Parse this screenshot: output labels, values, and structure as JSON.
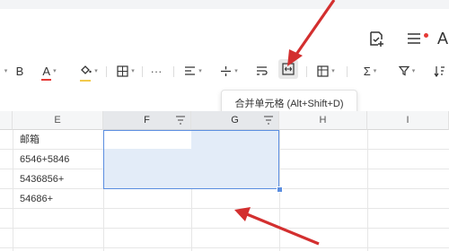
{
  "header": {
    "trailing_letter": "A"
  },
  "toolbar": {
    "bold_label": "B",
    "font_color_label": "A",
    "more_label": "···",
    "sum_label": "Σ",
    "font_color_underline": "#e53935",
    "fill_color_underline": "#f2c94c"
  },
  "tooltip": {
    "text": "合并单元格 (Alt+Shift+D)"
  },
  "columns": [
    {
      "label": "E"
    },
    {
      "label": "F"
    },
    {
      "label": "G"
    },
    {
      "label": "H"
    },
    {
      "label": "I"
    }
  ],
  "cells": {
    "e1": "邮箱",
    "e2": "6546+5846",
    "e3": "5436856+",
    "e4": "54686+"
  },
  "colors": {
    "selection_border": "#5b8ee0",
    "selection_fill": "#e3ecf8",
    "annotation_arrow": "#d32f2f"
  }
}
